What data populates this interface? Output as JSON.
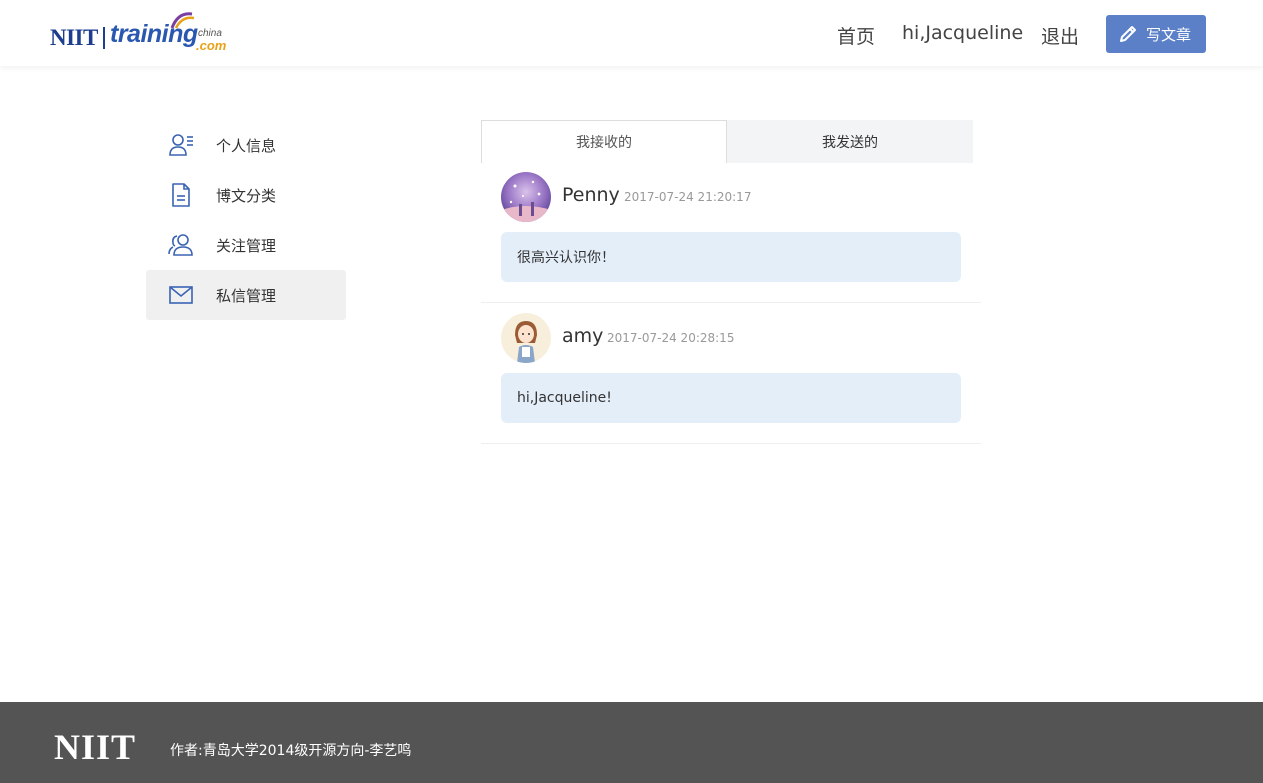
{
  "header": {
    "logo": {
      "niit": "NIIT",
      "training": "training",
      "china": "china",
      "com": ".com"
    },
    "nav": {
      "home": "首页",
      "user": "hi,Jacqueline",
      "logout": "退出"
    },
    "write_button": "写文章"
  },
  "sidebar": {
    "items": [
      {
        "label": "个人信息",
        "icon": "user-profile-icon"
      },
      {
        "label": "博文分类",
        "icon": "document-icon"
      },
      {
        "label": "关注管理",
        "icon": "users-icon"
      },
      {
        "label": "私信管理",
        "icon": "mail-icon",
        "active": true
      }
    ]
  },
  "tabs": [
    {
      "label": "我接收的",
      "active": true
    },
    {
      "label": "我发送的",
      "active": false
    }
  ],
  "messages": [
    {
      "sender": "Penny",
      "time": "2017-07-24 21:20:17",
      "text": "很高兴认识你！"
    },
    {
      "sender": "amy",
      "time": "2017-07-24 20:28:15",
      "text": "hi,Jacqueline!"
    }
  ],
  "footer": {
    "logo": "NIIT",
    "text": "作者:青岛大学2014级开源方向-李艺鸣"
  },
  "colors": {
    "accent": "#5b80c8",
    "bubble": "#e4eef9",
    "footer": "#545454"
  }
}
